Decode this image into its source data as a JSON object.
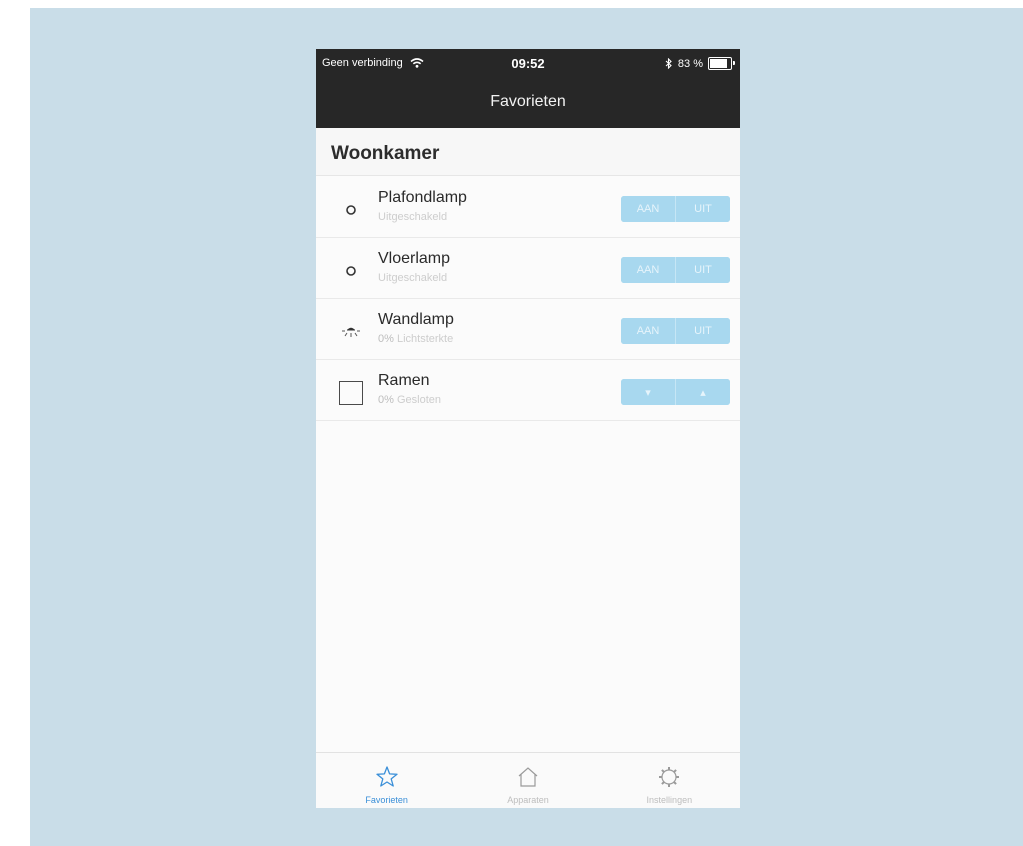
{
  "status_bar": {
    "carrier": "Geen verbinding",
    "time": "09:52",
    "battery": "83 %",
    "wifi_icon": "wifi-icon",
    "bluetooth_icon": "bluetooth-icon",
    "battery_icon": "battery-icon",
    "battery_level": 0.83
  },
  "header": {
    "title": "Favorieten"
  },
  "section": {
    "title": "Woonkamer"
  },
  "devices": [
    {
      "name": "Plafondlamp",
      "status_value": "",
      "status_text": "Uitgeschakeld",
      "icon": "lamp-off-icon",
      "buttons": [
        "AAN",
        "UIT"
      ]
    },
    {
      "name": "Vloerlamp",
      "status_value": "",
      "status_text": "Uitgeschakeld",
      "icon": "lamp-off-icon",
      "buttons": [
        "AAN",
        "UIT"
      ]
    },
    {
      "name": "Wandlamp",
      "status_value": "0%",
      "status_text": "Lichtsterkte",
      "icon": "dimmer-lamp-icon",
      "buttons": [
        "AAN",
        "UIT"
      ]
    },
    {
      "name": "Ramen",
      "status_value": "0%",
      "status_text": "Gesloten",
      "icon": "window-blind-icon",
      "buttons": [
        "▾",
        "▴"
      ]
    }
  ],
  "tabs": [
    {
      "label": "Favorieten",
      "icon": "star-icon",
      "active": true
    },
    {
      "label": "Apparaten",
      "icon": "house-icon",
      "active": false
    },
    {
      "label": "Instellingen",
      "icon": "gear-icon",
      "active": false
    }
  ],
  "colors": {
    "header_bg": "#272727",
    "button_bg": "#a8d8ef",
    "active_tab": "#3a8fd8",
    "backdrop": "#c9dde8"
  }
}
